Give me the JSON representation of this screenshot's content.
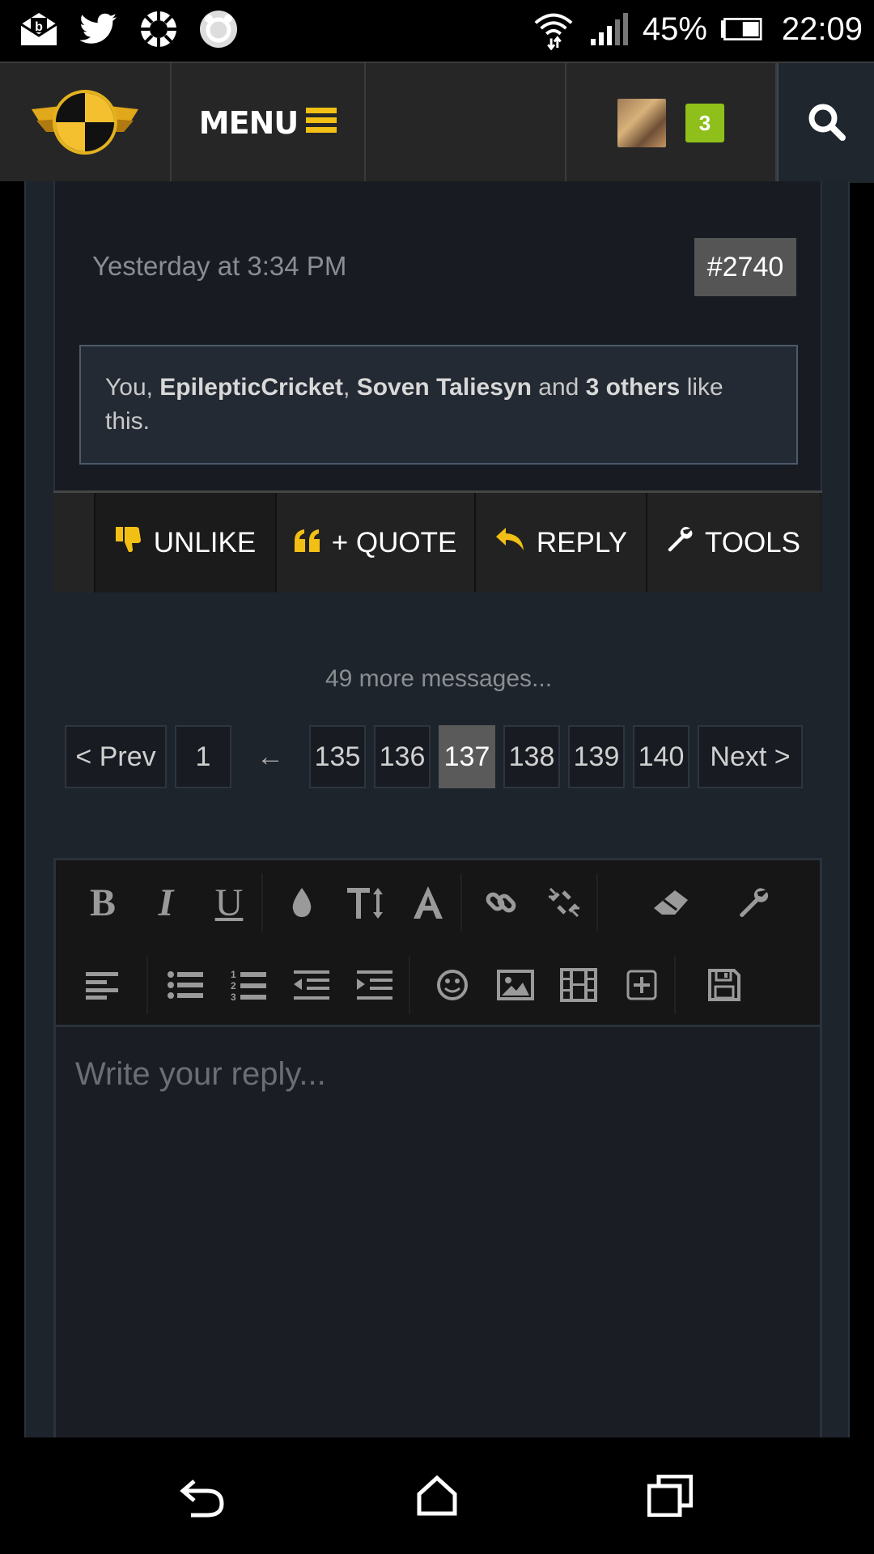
{
  "status_bar": {
    "battery_percent": "45%",
    "time": "22:09",
    "left_icons": [
      "mail-notification-icon",
      "twitter-icon",
      "aperture-icon",
      "bear-app-icon"
    ],
    "right_icons": [
      "wifi-icon",
      "signal-icon",
      "battery-icon"
    ]
  },
  "header": {
    "menu_label": "MENU",
    "notification_count": "3",
    "icons": [
      "site-logo-icon",
      "hamburger-icon",
      "avatar",
      "search-icon"
    ]
  },
  "post": {
    "timestamp": "Yesterday at 3:34 PM",
    "post_number": "#2740",
    "likes": {
      "prefix": "You, ",
      "user1": "EpilepticCricket",
      "sep": ", ",
      "user2": "Soven Taliesyn",
      "and": " and ",
      "others": "3 others",
      "suffix": " like this."
    },
    "actions": {
      "unlike": "UNLIKE",
      "quote": "+ QUOTE",
      "reply": "REPLY",
      "tools": "TOOLS"
    }
  },
  "more_messages": "49 more messages...",
  "pagination": {
    "prev": "< Prev",
    "first": "1",
    "skip": "←",
    "pages": [
      "135",
      "136",
      "137",
      "138",
      "139",
      "140"
    ],
    "current": "137",
    "next": "Next >"
  },
  "editor": {
    "toolbar_row1": [
      "bold-icon",
      "italic-icon",
      "underline-icon",
      "color-drop-icon",
      "font-size-icon",
      "font-family-icon",
      "link-icon",
      "unlink-icon",
      "eraser-icon",
      "wrench-icon"
    ],
    "toolbar_row2": [
      "align-left-icon",
      "bullet-list-icon",
      "numbered-list-icon",
      "outdent-icon",
      "indent-icon",
      "smiley-icon",
      "image-icon",
      "media-icon",
      "insert-icon",
      "save-icon"
    ],
    "bold_glyph": "B",
    "italic_glyph": "I",
    "underline_glyph": "U",
    "placeholder": "Write your reply..."
  },
  "colors": {
    "accent": "#F2C014",
    "notif_badge": "#8FBF1A",
    "active_page": "#5A5A5A"
  },
  "nav_bar": [
    "back-icon",
    "home-icon",
    "recents-icon"
  ]
}
